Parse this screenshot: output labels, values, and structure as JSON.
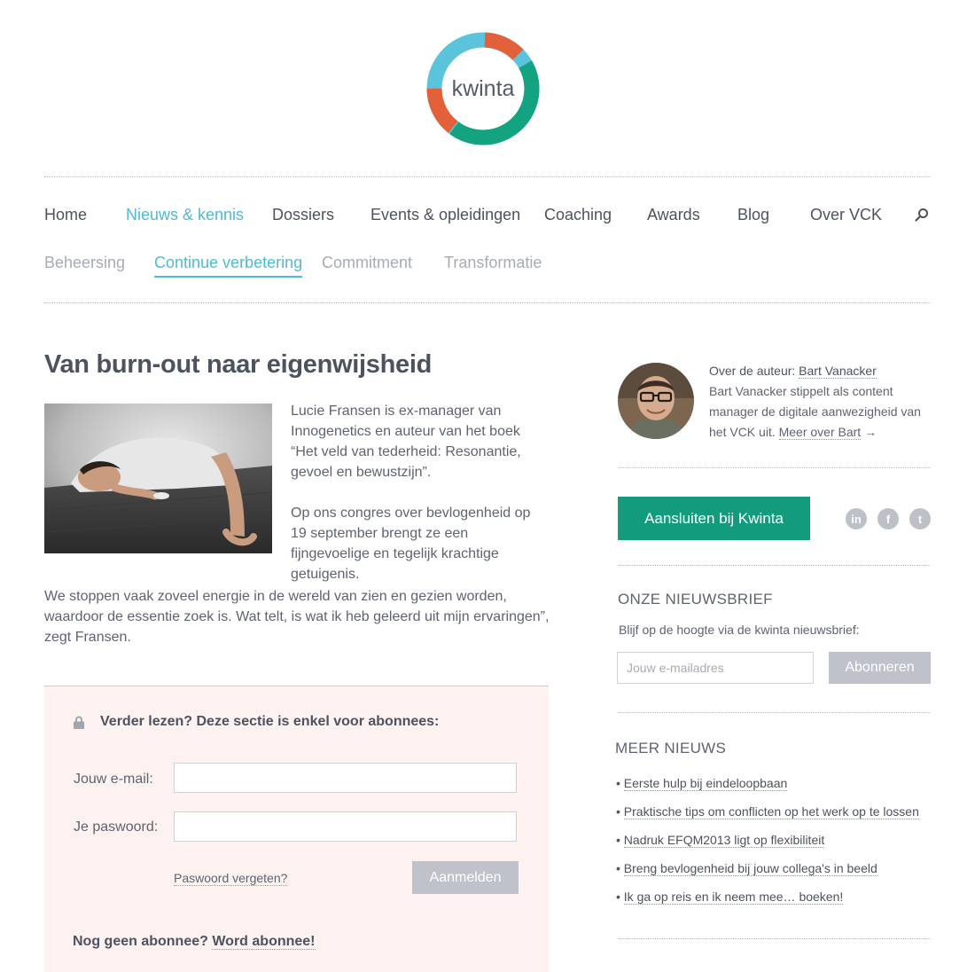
{
  "logo": {
    "text": "kwinta"
  },
  "nav": {
    "items": [
      {
        "label": "Home"
      },
      {
        "label": "Nieuws & kennis"
      },
      {
        "label": "Dossiers"
      },
      {
        "label": "Events & opleidingen"
      },
      {
        "label": "Coaching"
      },
      {
        "label": "Awards"
      },
      {
        "label": "Blog"
      },
      {
        "label": "Over VCK"
      }
    ],
    "active": "Nieuws & kennis",
    "search_icon": "search-icon"
  },
  "subnav": {
    "items": [
      {
        "label": "Beheersing"
      },
      {
        "label": "Continue verbetering"
      },
      {
        "label": "Commitment"
      },
      {
        "label": "Transformatie"
      }
    ],
    "active": "Continue verbetering"
  },
  "article": {
    "title": "Van burn-out naar eigenwijsheid",
    "paragraphs": [
      "Lucie Fransen is ex-manager van Innogenetics en auteur van het boek “Het veld van tederheid: Resonantie, gevoel en bewustzijn”.",
      "Op ons congres over bevlogenheid op 19 september brengt ze een fijngevoelige en tegelijk krachtige getuigenis.",
      "We stoppen vaak zoveel energie in de wereld van zien en gezien worden, waardoor de essentie zoek is. Wat telt, is wat ik heb geleerd uit mijn ervaringen”, zegt Fransen."
    ]
  },
  "paywall": {
    "title": "Verder lezen? Deze sectie is enkel voor abonnees:",
    "email_label": "Jouw e-mail:",
    "email_value": "",
    "password_label": "Je paswoord:",
    "password_value": "",
    "forgot_label": "Paswoord vergeten?",
    "login_label": "Aanmelden",
    "signup_prefix": "Nog geen abonnee?",
    "signup_link": "Word abonnee!"
  },
  "author": {
    "heading": "Over de auteur:",
    "name": "Bart Vanacker",
    "bio": "Bart Vanacker stippelt als content manager de digitale aanwezigheid van het VCK uit.",
    "more_label": "Meer over Bart",
    "arrow": "→"
  },
  "join": {
    "label": "Aansluiten bij Kwinta"
  },
  "social": [
    {
      "name": "linkedin-icon",
      "glyph": "in"
    },
    {
      "name": "facebook-icon",
      "glyph": "f"
    },
    {
      "name": "twitter-icon",
      "glyph": "t"
    }
  ],
  "newsletter": {
    "heading": "ONZE NIEUWSBRIEF",
    "intro": "Blijf op de hoogte via de kwinta nieuwsbrief:",
    "placeholder": "Jouw e-mailadres",
    "button": "Abonneren"
  },
  "more_news": {
    "heading": "MEER NIEUWS",
    "bullet": "•",
    "items": [
      "Eerste hulp bij eindeloopbaan",
      "Praktische tips om conflicten op het werk op te lossen",
      "Nadruk EFQM2013 ligt op flexibiliteit",
      "Breng bevlogenheid bij jouw collega's in beeld",
      "Ik ga op reis en ik neem mee… boeken!"
    ]
  },
  "colors": {
    "accent": "#4fbad3",
    "green": "#129c7d",
    "orange": "#e2613b",
    "paywall_bg": "#fdf2f0"
  }
}
